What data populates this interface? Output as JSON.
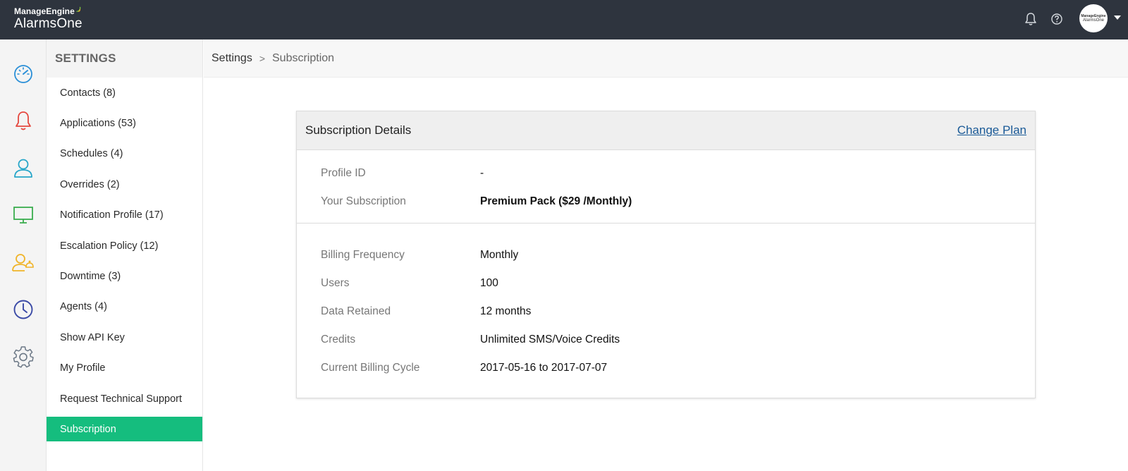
{
  "brand": {
    "company": "ManageEngine",
    "product": "AlarmsOne"
  },
  "topbar": {
    "icons": [
      "bell-icon",
      "help-icon"
    ],
    "avatar": {
      "line1": "ManageEngine",
      "line2": "AlarmsOne"
    }
  },
  "rail": {
    "items": [
      {
        "icon": "dashboard-icon",
        "color": "#2a8fd7"
      },
      {
        "icon": "alarm-bell-icon",
        "color": "#e5483f"
      },
      {
        "icon": "user-icon",
        "color": "#27a6c9"
      },
      {
        "icon": "monitor-icon",
        "color": "#3aad4e"
      },
      {
        "icon": "oncall-user-icon",
        "color": "#f0b429"
      },
      {
        "icon": "clock-icon",
        "color": "#3a4aa6"
      },
      {
        "icon": "settings-gear-icon",
        "color": "#6b7785"
      }
    ]
  },
  "sidebar": {
    "title": "SETTINGS",
    "items": [
      {
        "label": "Contacts (8)"
      },
      {
        "label": "Applications (53)"
      },
      {
        "label": "Schedules (4)"
      },
      {
        "label": "Overrides (2)"
      },
      {
        "label": "Notification Profile (17)"
      },
      {
        "label": "Escalation Policy (12)"
      },
      {
        "label": "Downtime (3)"
      },
      {
        "label": "Agents (4)"
      },
      {
        "label": "Show API Key"
      },
      {
        "label": "My Profile"
      },
      {
        "label": "Request Technical Support"
      },
      {
        "label": "Subscription",
        "active": true
      }
    ],
    "active_color": "#15bd7e"
  },
  "breadcrumb": {
    "parent": "Settings",
    "separator": ">",
    "current": "Subscription"
  },
  "card": {
    "title": "Subscription Details",
    "action": "Change Plan",
    "section1": [
      {
        "label": "Profile ID",
        "value": "-"
      },
      {
        "label": "Your Subscription",
        "value": "Premium Pack ($29 /Monthly)"
      }
    ],
    "section2": [
      {
        "label": "Billing Frequency",
        "value": "Monthly"
      },
      {
        "label": "Users",
        "value": "100"
      },
      {
        "label": "Data Retained",
        "value": "12 months"
      },
      {
        "label": "Credits",
        "value": "Unlimited SMS/Voice Credits"
      },
      {
        "label": "Current Billing Cycle",
        "value": "2017-05-16 to 2017-07-07"
      }
    ]
  }
}
